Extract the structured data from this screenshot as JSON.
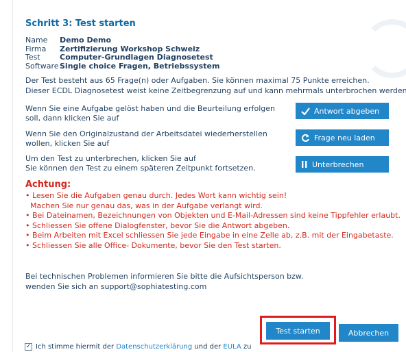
{
  "title": "Schritt 3: Test starten",
  "info": [
    {
      "label": "Name",
      "value": "Demo Demo"
    },
    {
      "label": "Firma",
      "value": "Zertifizierung Workshop Schweiz"
    },
    {
      "label": "Test",
      "value": "Computer-Grundlagen Diagnosetest"
    },
    {
      "label": "Software",
      "value": "Single choice Fragen, Betriebssystem"
    }
  ],
  "intro": {
    "line1": "Der Test besteht aus 65 Frage(n) oder Aufgaben. Sie können maximal 75 Punkte erreichen.",
    "line2": "Dieser ECDL Diagnosetest weist keine Zeitbegrenzung auf und kann mehrmals unterbrochen werden."
  },
  "actions": {
    "submit": {
      "text1": "Wenn Sie eine Aufgabe gelöst haben und die Beurteilung erfolgen",
      "text2": "soll, dann klicken Sie auf",
      "button": "Antwort abgeben",
      "icon": "check-icon"
    },
    "reload": {
      "text1": "Wenn Sie den Originalzustand der Arbeitsdatei wiederherstellen",
      "text2": "wollen, klicken Sie auf",
      "button": "Frage neu laden",
      "icon": "reload-icon"
    },
    "pause": {
      "text1": "Um den Test zu unterbrechen, klicken Sie auf",
      "text2": "Sie können den Test zu einem späteren Zeitpunkt fortsetzen.",
      "button": "Unterbrechen",
      "icon": "pause-icon"
    }
  },
  "warning": {
    "title": "Achtung:",
    "items": [
      "• Lesen Sie die Aufgaben genau durch. Jedes Wort kann wichtig sein!",
      "  Machen Sie nur genau das, was in der Aufgabe verlangt wird.",
      "• Bei Dateinamen, Bezeichnungen von Objekten und E-Mail-Adressen sind keine Tippfehler erlaubt.",
      "• Schliessen Sie offene Dialogfenster, bevor Sie die Antwort abgeben.",
      "• Beim Arbeiten mit Excel schliessen Sie jede Eingabe in eine Zelle ab, z.B. mit der Eingabetaste.",
      "• Schliessen Sie alle Office- Dokumente, bevor Sie den Test starten."
    ]
  },
  "support": {
    "line1": "Bei technischen Problemen informieren Sie bitte die Aufsichtsperson bzw.",
    "line2": "wenden Sie sich an support@sophiatesting.com"
  },
  "buttons": {
    "start": "Test starten",
    "cancel": "Abbrechen"
  },
  "consent": {
    "checked": true,
    "text_before": "Ich stimme hiermit der",
    "link1": "Datenschutzerklärung",
    "text_middle": "und der",
    "link2": "EULA",
    "text_after": "zu"
  },
  "colors": {
    "accent": "#2187c9",
    "title": "#0b6aa6",
    "warning": "#d12a1e",
    "highlight": "#e01b1b",
    "text": "#1f3f5f"
  }
}
